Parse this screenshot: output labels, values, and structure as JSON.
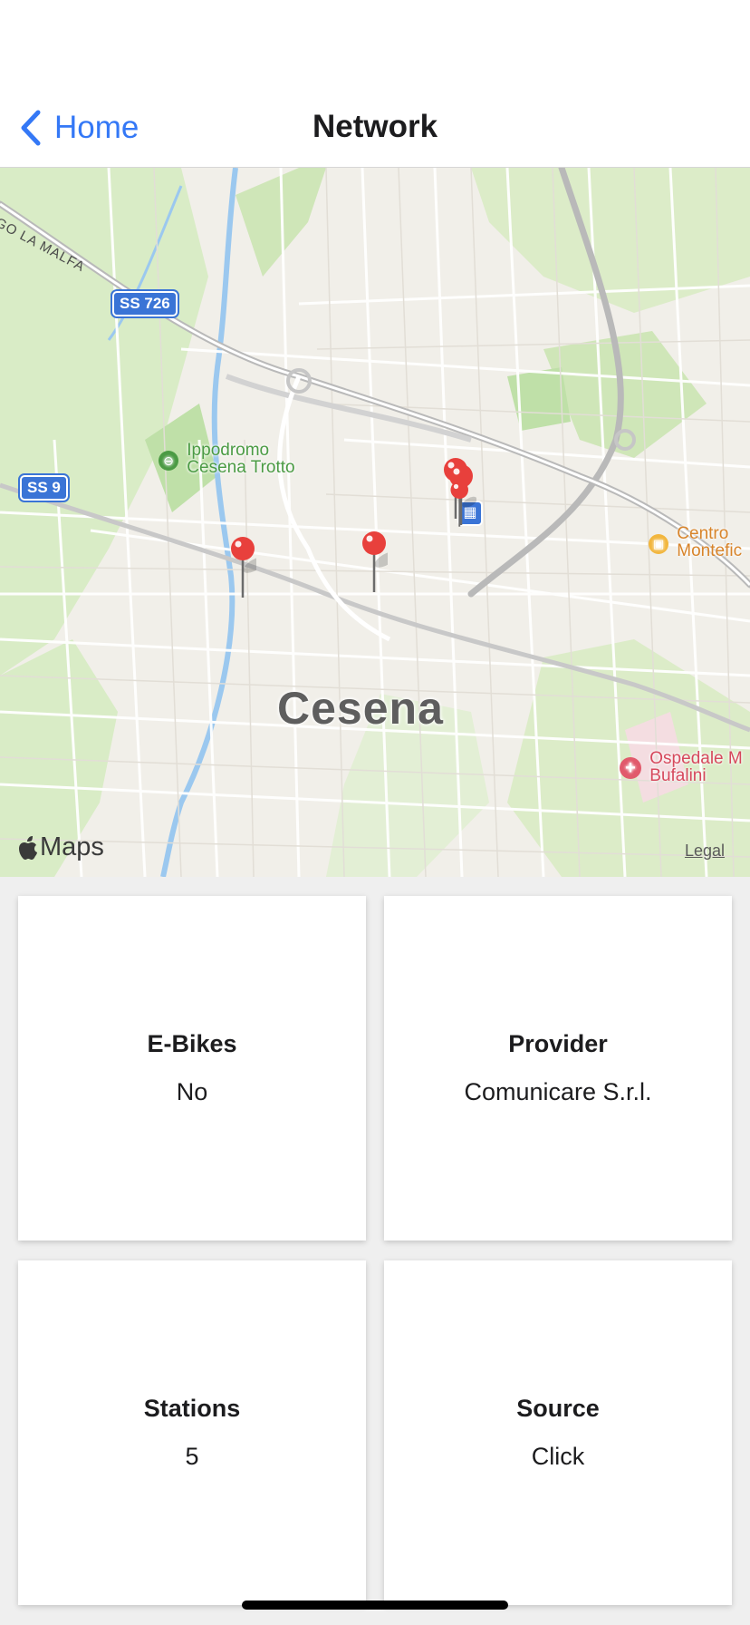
{
  "nav": {
    "back_label": "Home",
    "title": "Network"
  },
  "map": {
    "city": "Cesena",
    "road_badges": [
      "SS 726",
      "SS 9"
    ],
    "road_name": "GO LA MALFA",
    "poi": {
      "ippodromo": [
        "Ippodromo",
        "Cesena Trotto"
      ],
      "centro": [
        "Centro",
        "Montefic"
      ],
      "ospedale": [
        "Ospedale M",
        "Bufalini"
      ]
    },
    "attribution": "Maps",
    "legal": "Legal",
    "pin_color": "#e8403c"
  },
  "cards": [
    {
      "title": "E-Bikes",
      "value": "No"
    },
    {
      "title": "Provider",
      "value": "Comunicare S.r.l."
    },
    {
      "title": "Stations",
      "value": "5"
    },
    {
      "title": "Source",
      "value": "Click"
    }
  ]
}
